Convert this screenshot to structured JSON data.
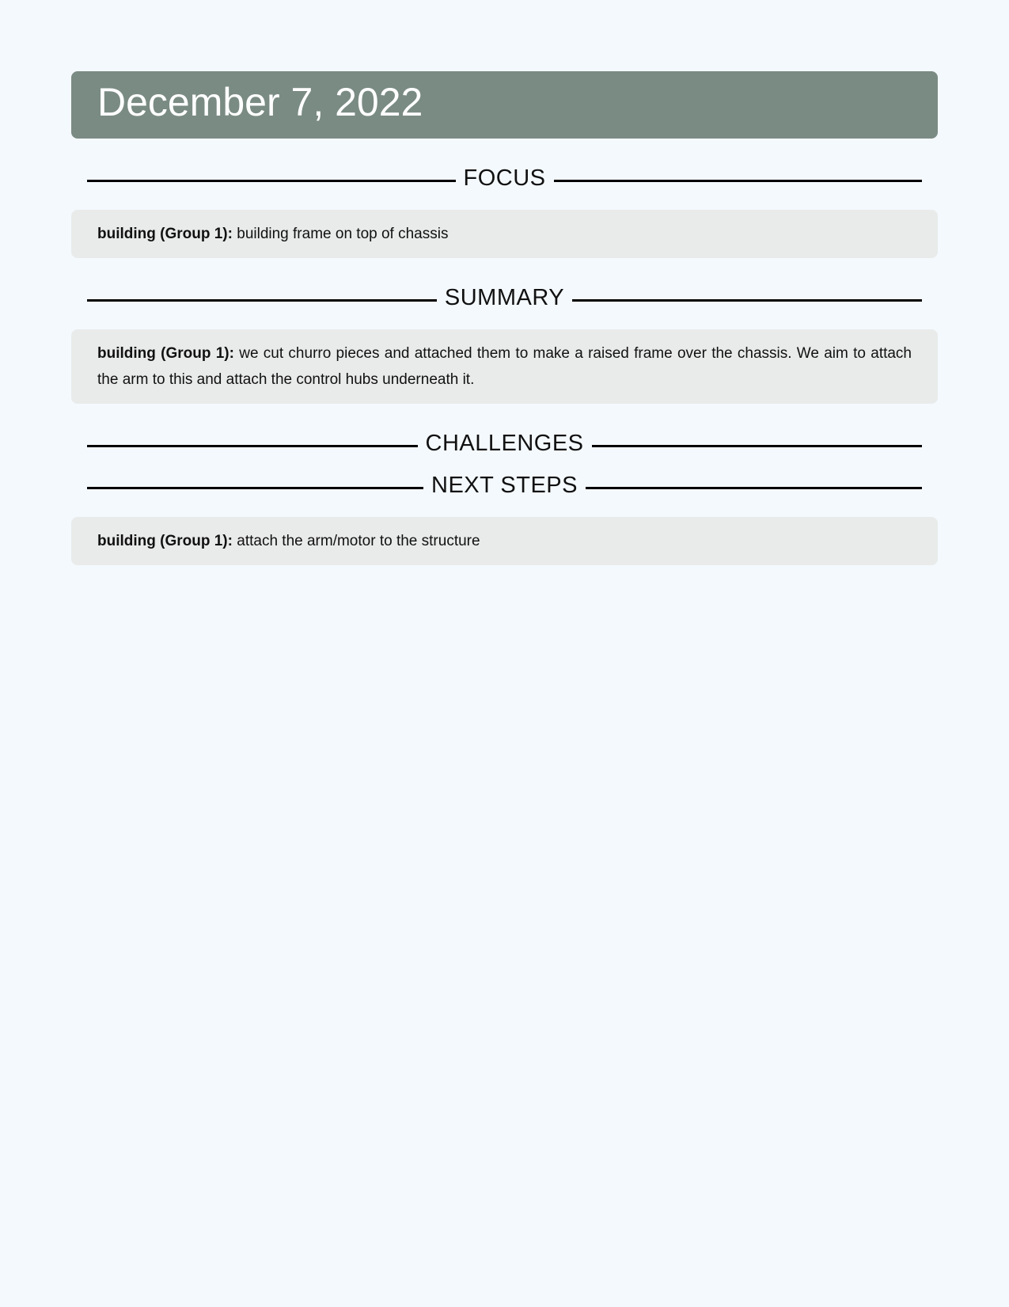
{
  "header": {
    "date": "December 7, 2022"
  },
  "sections": {
    "focus": {
      "title": "FOCUS",
      "entries": [
        {
          "label": "building (Group 1):",
          "text": "building frame on top of chassis"
        }
      ]
    },
    "summary": {
      "title": "SUMMARY",
      "entries": [
        {
          "label": "building (Group 1):",
          "text": "we cut churro pieces and attached them to make a raised frame over the chassis.  We aim to attach the arm to this and attach the control hubs underneath it."
        }
      ]
    },
    "challenges": {
      "title": "CHALLENGES",
      "entries": []
    },
    "next_steps": {
      "title": "NEXT STEPS",
      "entries": [
        {
          "label": "building (Group 1):",
          "text": "attach the arm/motor to the structure"
        }
      ]
    }
  },
  "colors": {
    "background": "#f4f9fd",
    "banner": "#7a8b83",
    "entry_box": "#e9ebea",
    "rule": "#000000"
  }
}
